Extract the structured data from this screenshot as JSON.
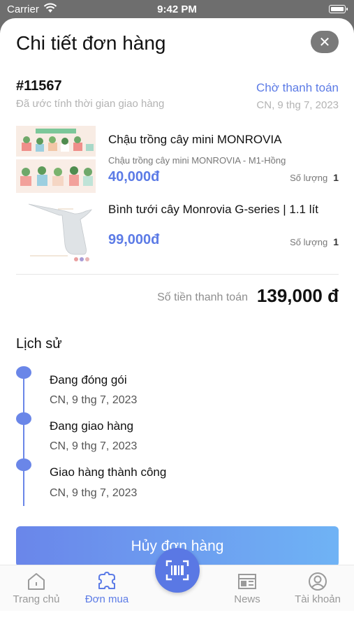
{
  "status_bar": {
    "carrier": "Carrier",
    "time": "9:42 PM"
  },
  "header": {
    "title": "Chi tiết đơn hàng",
    "close_icon": "close-icon"
  },
  "order": {
    "id": "#11567",
    "subtitle": "Đã ước tính thời gian giao hàng",
    "status": "Chờ thanh toán",
    "date": "CN, 9 thg 7, 2023",
    "status_color": "#5c7be6"
  },
  "products": [
    {
      "name": "Chậu trồng cây mini MONROVIA",
      "variant": "Chậu trồng cây mini MONROVIA - M1-Hồng",
      "price": "40,000đ",
      "qty_label": "Số lượng",
      "qty": "1"
    },
    {
      "name": "Bình tưới cây Monrovia G-series | 1.1 lít",
      "variant": "",
      "price": "99,000đ",
      "qty_label": "Số lượng",
      "qty": "1"
    }
  ],
  "total": {
    "label": "Số tiền thanh toán",
    "value": "139,000 đ"
  },
  "history": {
    "title": "Lịch sử",
    "events": [
      {
        "title": "Đang đóng gói",
        "date": "CN, 9 thg 7, 2023"
      },
      {
        "title": "Đang giao hàng",
        "date": "CN, 9 thg 7, 2023"
      },
      {
        "title": "Giao hàng thành công",
        "date": "CN, 9 thg 7, 2023"
      }
    ]
  },
  "cancel_button": "Hủy đơn hàng",
  "tabbar": {
    "tabs": [
      {
        "label": "Trang chủ",
        "icon": "home-icon"
      },
      {
        "label": "Đơn mua",
        "icon": "order-icon",
        "active": true
      },
      {
        "label": "News",
        "icon": "news-icon"
      },
      {
        "label": "Tài khoản",
        "icon": "account-icon"
      }
    ],
    "scan_icon": "scan-icon"
  },
  "colors": {
    "accent": "#5c7be6",
    "timeline": "#6a86e8",
    "button_gradient_start": "#6a86ea",
    "button_gradient_end": "#6fb3f5"
  }
}
